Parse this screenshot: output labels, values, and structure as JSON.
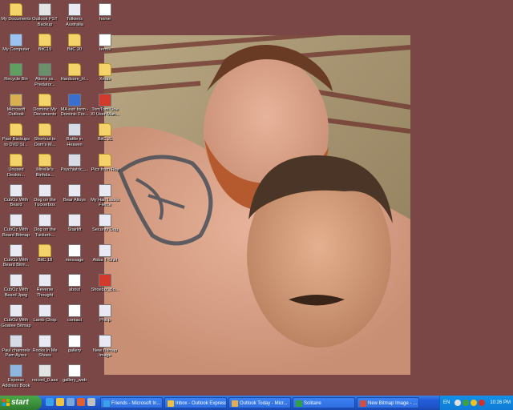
{
  "desktop": {
    "icons": [
      {
        "label": "My Documents",
        "icon": "folder-docs-icon",
        "color": "#f3d36a"
      },
      {
        "label": "My Computer",
        "icon": "computer-icon",
        "color": "#9cc3ef"
      },
      {
        "label": "Recycle Bin",
        "icon": "recycle-bin-icon",
        "color": "#5f9f5f"
      },
      {
        "label": "Microsoft Outlook",
        "icon": "outlook-icon",
        "color": "#d9b04f"
      },
      {
        "label": "Past Backups to DVD St...",
        "icon": "folder-icon",
        "color": "#f3d36a"
      },
      {
        "label": "Unused Deskto...",
        "icon": "folder-icon",
        "color": "#f3d36a"
      },
      {
        "label": "CubOz With Beard",
        "icon": "image-file-icon",
        "color": "#e9e9f3"
      },
      {
        "label": "CubOz With Beard Bitmap",
        "icon": "image-file-icon",
        "color": "#e9e9f3"
      },
      {
        "label": "CubOz With Beard Bitm...",
        "icon": "image-file-icon",
        "color": "#e9e9f3"
      },
      {
        "label": "CubOz With Beard Jpeg",
        "icon": "image-file-icon",
        "color": "#e9e9f3"
      },
      {
        "label": "CubOz With Goatee Bitmap",
        "icon": "image-file-icon",
        "color": "#e9e9f3"
      },
      {
        "label": "Paul channels Pam Ayres",
        "icon": "media-file-icon",
        "color": "#d7dbe6"
      },
      {
        "label": "Express Address Book",
        "icon": "address-book-icon",
        "color": "#8fb6e0"
      },
      {
        "label": "Outlook PST Backup",
        "icon": "pst-file-icon",
        "color": "#e3e3e3"
      },
      {
        "label": "BitC15",
        "icon": "folder-icon",
        "color": "#f3d36a"
      },
      {
        "label": "Aliens vs. Predator...",
        "icon": "game-icon",
        "color": "#6a8f6a"
      },
      {
        "label": "Dominic My Documents",
        "icon": "folder-docs-icon",
        "color": "#f3d36a"
      },
      {
        "label": "Shortcut to Dom's M...",
        "icon": "folder-icon",
        "color": "#f3d36a"
      },
      {
        "label": "Mireille's Birthda...",
        "icon": "folder-icon",
        "color": "#f3d36a"
      },
      {
        "label": "Dog on the Tuckerbox",
        "icon": "image-file-icon",
        "color": "#e9e9f3"
      },
      {
        "label": "Dog on the Tuckerb...",
        "icon": "image-file-icon",
        "color": "#e9e9f3"
      },
      {
        "label": "BitC 18",
        "icon": "folder-icon",
        "color": "#f3d36a"
      },
      {
        "label": "Reverse Thought",
        "icon": "image-file-icon",
        "color": "#e9e9f3"
      },
      {
        "label": "Lamb Chop",
        "icon": "image-file-icon",
        "color": "#e9e9f3"
      },
      {
        "label": "Rocks In Me Shoes",
        "icon": "image-file-icon",
        "color": "#e9e9f3"
      },
      {
        "label": "record_0.asx",
        "icon": "asx-file-icon",
        "color": "#e3e3e3"
      },
      {
        "label": "Tolkiens Australia",
        "icon": "image-file-icon",
        "color": "#e9e9f3"
      },
      {
        "label": "BitC 20",
        "icon": "folder-icon",
        "color": "#f3d36a"
      },
      {
        "label": "Hardcore_H...",
        "icon": "folder-icon",
        "color": "#f3d36a"
      },
      {
        "label": "MA exit form - Dominic Fre...",
        "icon": "word-doc-icon",
        "color": "#3a6fd0"
      },
      {
        "label": "Battle in Heaven",
        "icon": "media-file-icon",
        "color": "#d7dbe6"
      },
      {
        "label": "Psychiatric_...",
        "icon": "media-file-icon",
        "color": "#d7dbe6"
      },
      {
        "label": "Bear Alloys",
        "icon": "image-file-icon",
        "color": "#e9e9f3"
      },
      {
        "label": "Stairlift",
        "icon": "image-file-icon",
        "color": "#e9e9f3"
      },
      {
        "label": "message",
        "icon": "document-icon",
        "color": "#ffffff"
      },
      {
        "label": "about",
        "icon": "document-icon",
        "color": "#ffffff"
      },
      {
        "label": "contact",
        "icon": "document-icon",
        "color": "#ffffff"
      },
      {
        "label": "gallery",
        "icon": "document-icon",
        "color": "#ffffff"
      },
      {
        "label": "gallery_web",
        "icon": "document-icon",
        "color": "#ffffff"
      },
      {
        "label": "home",
        "icon": "document-icon",
        "color": "#ffffff"
      },
      {
        "label": "terms",
        "icon": "document-icon",
        "color": "#ffffff"
      },
      {
        "label": "Xmas",
        "icon": "folder-icon",
        "color": "#f3d36a"
      },
      {
        "label": "TomTom One XI User Man...",
        "icon": "pdf-file-icon",
        "color": "#d23b2b"
      },
      {
        "label": "BitC 21",
        "icon": "folder-icon",
        "color": "#f3d36a"
      },
      {
        "label": "Pics from Roy",
        "icon": "folder-icon",
        "color": "#f3d36a"
      },
      {
        "label": "My Hair Looks Fierce",
        "icon": "image-file-icon",
        "color": "#e9e9f3"
      },
      {
        "label": "Security Dog",
        "icon": "image-file-icon",
        "color": "#e9e9f3"
      },
      {
        "label": "Abba T-Shirt",
        "icon": "image-file-icon",
        "color": "#e9e9f3"
      },
      {
        "label": "Shoebiz_Bo...",
        "icon": "pdf-file-icon",
        "color": "#d23b2b"
      },
      {
        "label": "Philip",
        "icon": "image-file-icon",
        "color": "#e9e9f3"
      },
      {
        "label": "New Bitmap Image",
        "icon": "image-file-icon",
        "color": "#e9e9f3"
      }
    ]
  },
  "taskbar": {
    "start_label": "start",
    "tasks": [
      {
        "label": "Friends - Microsoft In...",
        "icon": "ie-icon",
        "color": "#3aa0e8"
      },
      {
        "label": "Inbox - Outlook Express",
        "icon": "outlook-express-icon",
        "color": "#f0c040"
      },
      {
        "label": "Outlook Today - Micr...",
        "icon": "outlook-icon",
        "color": "#e0b050"
      },
      {
        "label": "Solitaire",
        "icon": "solitaire-icon",
        "color": "#30a040"
      },
      {
        "label": "New Bitmap Image - ...",
        "icon": "paint-icon",
        "color": "#d05040"
      }
    ],
    "tray": {
      "language": "EN",
      "clock": "10:26 PM"
    }
  }
}
